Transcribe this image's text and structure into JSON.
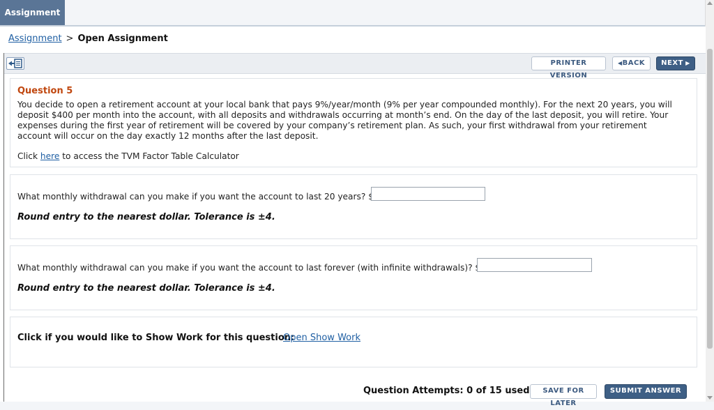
{
  "tabs": {
    "active": "Assignment"
  },
  "breadcrumb": {
    "link": "Assignment",
    "separator": ">",
    "current": "Open Assignment"
  },
  "toolbar": {
    "collapse_icon": "collapse-panel-icon",
    "printer_label": "PRINTER VERSION",
    "back_label": "BACK",
    "next_label": "NEXT"
  },
  "question": {
    "title": "Question 5",
    "text": "You decide to open a retirement account at your local bank that pays 9%/year/month (9% per year compounded monthly). For the next 20 years, you will deposit $400 per month into the account, with all deposits and withdrawals occurring at month’s end. On the day of the last deposit, you will retire. Your expenses during the first year of retirement will be covered by your company’s retirement plan. As such, your first withdrawal from your retirement account will occur on the day exactly 12 months after the last deposit.",
    "click_prefix": "Click ",
    "click_link": "here",
    "click_suffix": " to access the TVM Factor Table Calculator"
  },
  "part1": {
    "prompt": "What monthly withdrawal can you make if you want the account to last 20 years? $",
    "value": "",
    "hint": "Round entry to the nearest dollar. Tolerance is ±4."
  },
  "part2": {
    "prompt": "What monthly withdrawal can you make if you want the account to last forever (with infinite withdrawals)? $",
    "value": "",
    "hint": "Round entry to the nearest dollar. Tolerance is ±4."
  },
  "showwork": {
    "label": "Click if you would like to Show Work for this question:",
    "link": "Open Show Work"
  },
  "footer": {
    "attempts": "Question Attempts: 0 of 15 used",
    "save_label": "SAVE FOR LATER",
    "submit_label": "SUBMIT ANSWER"
  },
  "colors": {
    "accent": "#3e5f85",
    "question_title": "#c0470f",
    "link": "#1f5fa3"
  }
}
